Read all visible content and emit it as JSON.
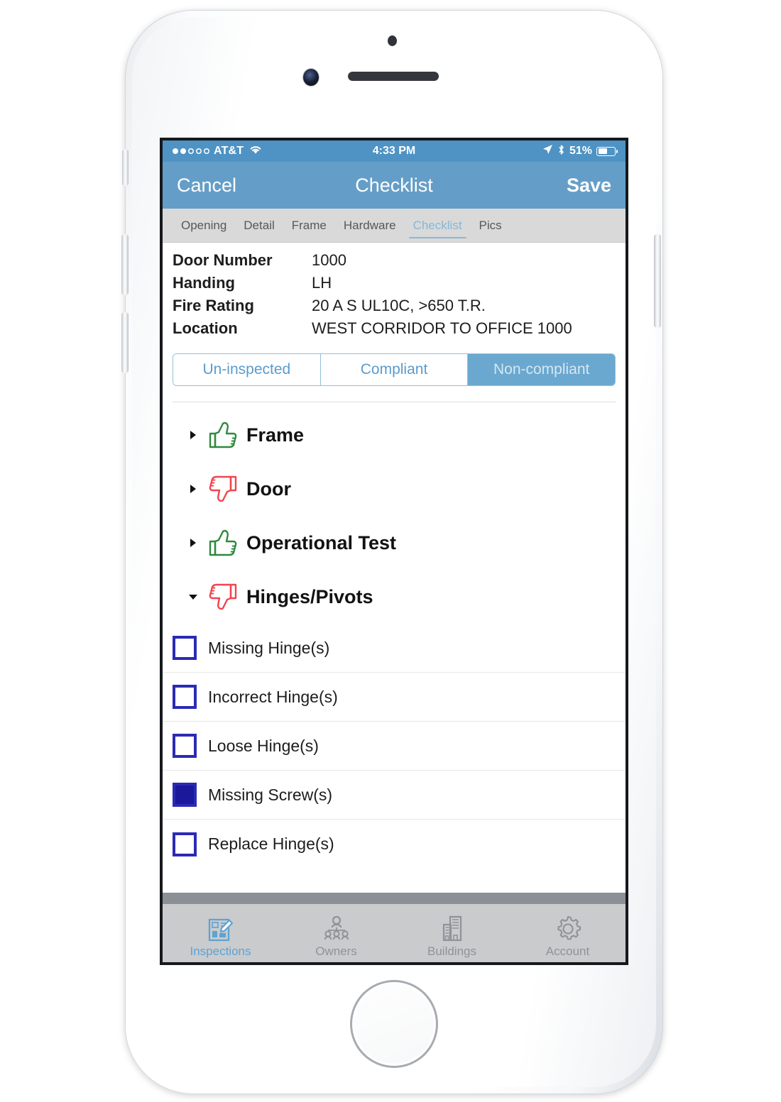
{
  "device": {
    "name": "iphone-white",
    "hardware": [
      "front-camera",
      "earpiece-speaker",
      "sensor",
      "home-button",
      "silent-switch",
      "volume-up",
      "volume-down",
      "power-button"
    ]
  },
  "status_bar": {
    "carrier": "AT&T",
    "signal_filled": 2,
    "signal_total": 5,
    "wifi": "wifi-icon",
    "time": "4:33 PM",
    "location_arrow": "location-arrow-icon",
    "bluetooth": "bluetooth-icon",
    "battery_percent": "51%",
    "battery_level": 51,
    "bar_color": "#4e93c4"
  },
  "nav_bar": {
    "cancel_label": "Cancel",
    "title": "Checklist",
    "save_label": "Save",
    "bar_color": "#649ec8"
  },
  "tabs": {
    "items": [
      {
        "label": "Opening",
        "active": false
      },
      {
        "label": "Detail",
        "active": false
      },
      {
        "label": "Frame",
        "active": false
      },
      {
        "label": "Hardware",
        "active": false
      },
      {
        "label": "Checklist",
        "active": true
      },
      {
        "label": "Pics",
        "active": false
      }
    ],
    "active_color": "#85b7d8",
    "bar_color": "#d9d9d9"
  },
  "info": {
    "rows": [
      {
        "label": "Door Number",
        "value": "1000"
      },
      {
        "label": "Handing",
        "value": "LH"
      },
      {
        "label": "Fire Rating",
        "value": "20 A S UL10C, >650 T.R."
      },
      {
        "label": "Location",
        "value": "WEST CORRIDOR TO OFFICE 1000"
      }
    ]
  },
  "status_segmented": {
    "options": [
      {
        "label": "Un-inspected",
        "selected": false
      },
      {
        "label": "Compliant",
        "selected": false
      },
      {
        "label": "Non-compliant",
        "selected": true
      }
    ],
    "selected": "Non-compliant",
    "accent_color": "#6aa8cf",
    "border_color": "#8fc0de"
  },
  "categories": [
    {
      "label": "Frame",
      "rating": "thumbs-up",
      "expanded": false,
      "color": "#2f8a3f"
    },
    {
      "label": "Door",
      "rating": "thumbs-down",
      "expanded": false,
      "color": "#f1454f"
    },
    {
      "label": "Operational Test",
      "rating": "thumbs-up",
      "expanded": false,
      "color": "#2f8a3f"
    },
    {
      "label": "Hinges/Pivots",
      "rating": "thumbs-down",
      "expanded": true,
      "color": "#f1454f"
    }
  ],
  "checklist": {
    "parent": "Hinges/Pivots",
    "items": [
      {
        "label": "Missing Hinge(s)",
        "checked": false
      },
      {
        "label": "Incorrect Hinge(s)",
        "checked": false
      },
      {
        "label": "Loose Hinge(s)",
        "checked": false
      },
      {
        "label": "Missing Screw(s)",
        "checked": true
      },
      {
        "label": "Replace Hinge(s)",
        "checked": false
      }
    ],
    "checkbox_border_color": "#2a2ab5",
    "checkbox_fill_color": "#1c189c"
  },
  "bottom_tabs": {
    "items": [
      {
        "label": "Inspections",
        "icon": "clipboard-pencil-icon",
        "active": true
      },
      {
        "label": "Owners",
        "icon": "people-group-icon",
        "active": false
      },
      {
        "label": "Buildings",
        "icon": "buildings-icon",
        "active": false
      },
      {
        "label": "Account",
        "icon": "gear-icon",
        "active": false
      }
    ],
    "active_color": "#5da3d4",
    "inactive_color": "#8f9398",
    "bar_color": "#c9cbcd"
  }
}
